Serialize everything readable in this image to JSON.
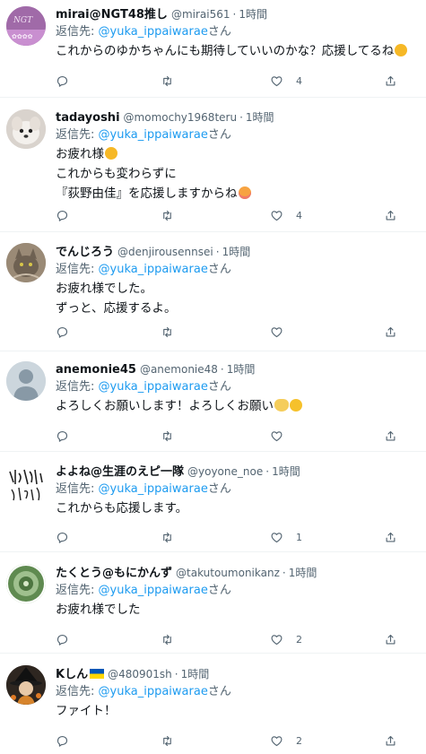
{
  "replies": [
    {
      "display_name": "mirai@NGT48推し",
      "handle": "@mirai561",
      "time": "1時間",
      "reply_prefix": "返信先: ",
      "reply_to": "@yuka_ippaiwarae",
      "reply_suffix": "さん",
      "lines": [
        "これからのゆかちゃんにも期待していいのかな？応援してるね"
      ],
      "likes": "4",
      "avatar_color": "#b07ab8"
    },
    {
      "display_name": "tadayoshi",
      "handle": "@momochy1968teru",
      "time": "1時間",
      "reply_prefix": "返信先: ",
      "reply_to": "@yuka_ippaiwarae",
      "reply_suffix": "さん",
      "lines": [
        "お疲れ様",
        "これからも変わらずに",
        "『荻野由佳』を応援しますからね"
      ],
      "likes": "4",
      "avatar_color": "#cfc8c2"
    },
    {
      "display_name": "でんじろう",
      "handle": "@denjirousennsei",
      "time": "1時間",
      "reply_prefix": "返信先: ",
      "reply_to": "@yuka_ippaiwarae",
      "reply_suffix": "さん",
      "lines": [
        "お疲れ様でした。",
        "ずっと、応援するよ。"
      ],
      "likes": "",
      "avatar_color": "#8a7a68"
    },
    {
      "display_name": "anemonie45",
      "handle": "@anemonie48",
      "time": "1時間",
      "reply_prefix": "返信先: ",
      "reply_to": "@yuka_ippaiwarae",
      "reply_suffix": "さん",
      "lines": [
        "よろしくお願いします！よろしくお願い"
      ],
      "likes": "",
      "avatar_color": "#ccd6dd"
    },
    {
      "display_name": "よよね@生涯のえピ一隊",
      "handle": "@yoyone_noe",
      "time": "1時間",
      "reply_prefix": "返信先: ",
      "reply_to": "@yuka_ippaiwarae",
      "reply_suffix": "さん",
      "lines": [
        "これからも応援します。"
      ],
      "likes": "1",
      "avatar_color": "#ffffff"
    },
    {
      "display_name": "たくとう@もにかんず",
      "handle": "@takutoumonikanz",
      "time": "1時間",
      "reply_prefix": "返信先: ",
      "reply_to": "@yuka_ippaiwarae",
      "reply_suffix": "さん",
      "lines": [
        "お疲れ様でした"
      ],
      "likes": "2",
      "avatar_color": "#6f9a5c"
    },
    {
      "display_name": "Kしん",
      "handle": "@480901sh",
      "time": "1時間",
      "reply_prefix": "返信先: ",
      "reply_to": "@yuka_ippaiwarae",
      "reply_suffix": "さん",
      "lines": [
        "ファイト！"
      ],
      "likes": "2",
      "avatar_color": "#3b2f24"
    }
  ],
  "colors": {
    "link": "#1d9bf0",
    "secondary_text": "#536471",
    "divider": "#eff3f4"
  },
  "icons": [
    "reply-icon",
    "retweet-icon",
    "like-icon",
    "share-icon",
    "hug-emoji",
    "smile-emoji",
    "open-hands-emoji",
    "pleading-face-emoji",
    "ukraine-flag-emoji"
  ]
}
